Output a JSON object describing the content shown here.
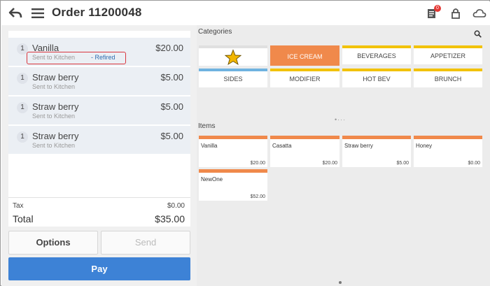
{
  "header": {
    "title": "Order 11200048",
    "badge_count": "0",
    "icons": [
      "back-arrow-icon",
      "menu-icon",
      "orders-icon",
      "lock-icon",
      "cloud-icon"
    ]
  },
  "order": {
    "items": [
      {
        "qty": "1",
        "name": "Vanilla",
        "price": "$20.00",
        "status": "Sent to Kitchen",
        "flag": "- Refired"
      },
      {
        "qty": "1",
        "name": "Straw berry",
        "price": "$5.00",
        "status": "Sent to Kitchen",
        "flag": ""
      },
      {
        "qty": "1",
        "name": "Straw berry",
        "price": "$5.00",
        "status": "Sent to Kitchen",
        "flag": ""
      },
      {
        "qty": "1",
        "name": "Straw berry",
        "price": "$5.00",
        "status": "Sent to Kitchen",
        "flag": ""
      }
    ],
    "tax_label": "Tax",
    "tax_value": "$0.00",
    "total_label": "Total",
    "total_value": "$35.00"
  },
  "actions": {
    "options_label": "Options",
    "send_label": "Send",
    "pay_label": "Pay"
  },
  "categories": {
    "label": "Categories",
    "tiles": [
      {
        "label": "",
        "icon": "star-icon"
      },
      {
        "label": "ICE CREAM"
      },
      {
        "label": "BEVERAGES"
      },
      {
        "label": "APPETIZER"
      },
      {
        "label": "SIDES"
      },
      {
        "label": "MODIFIER"
      },
      {
        "label": "HOT BEV"
      },
      {
        "label": "BRUNCH"
      }
    ]
  },
  "items": {
    "label": "Items",
    "tiles": [
      {
        "name": "Vanilla",
        "price": "$20.00"
      },
      {
        "name": "Casatta",
        "price": "$20.00"
      },
      {
        "name": "Straw berry",
        "price": "$5.00"
      },
      {
        "name": "Honey",
        "price": "$0.00"
      },
      {
        "name": "NewOne",
        "price": "$52.00"
      }
    ]
  },
  "colors": {
    "accent_blue": "#3d82d6",
    "orange": "#f0894b",
    "yellow": "#f2c200",
    "light_blue": "#6fb3e0",
    "highlight_red": "#d9363e"
  }
}
